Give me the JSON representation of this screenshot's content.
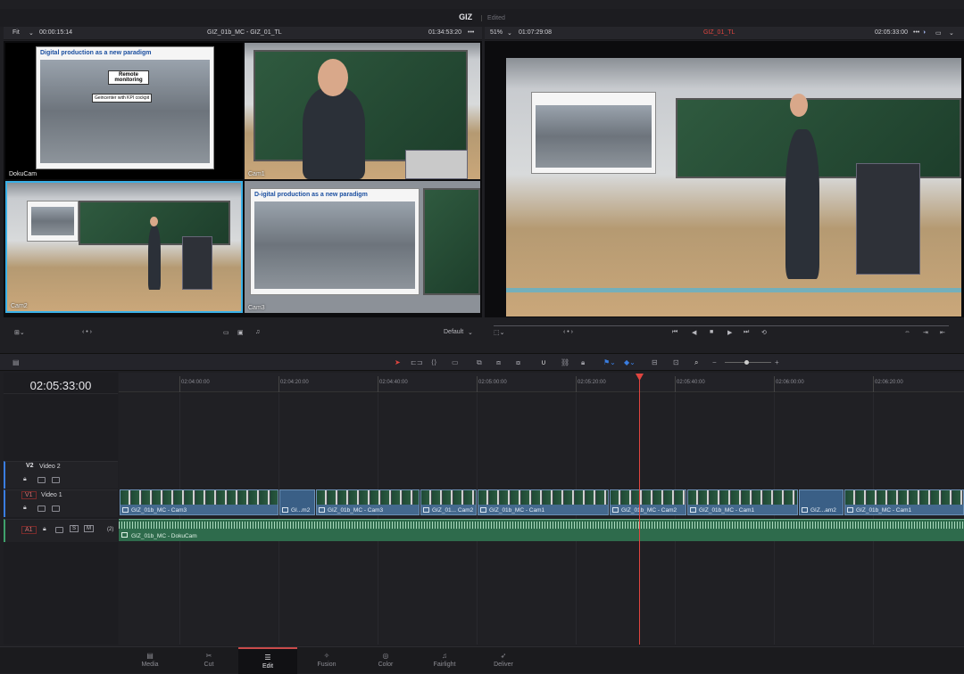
{
  "app": {
    "project_title": "GIZ",
    "status": "Edited"
  },
  "source_viewer": {
    "zoom": "Fit",
    "duration": "00:00:15:14",
    "clip_name": "GIZ_01b_MC - GIZ_01_TL",
    "timecode": "01:34:53:20",
    "more": "•••",
    "angles": [
      {
        "label": "DokuCam"
      },
      {
        "label": "Cam1"
      },
      {
        "label": "Cam2"
      },
      {
        "label": "Cam3"
      }
    ],
    "slide_title": "Digital production as a new paradigm",
    "slide_title_cam3": "D-igital production as a new paradigm",
    "slide_callout": "Remote monitoring",
    "slide_callout2": "Geincenter with KPI cockpit",
    "nav": "‹ • ›"
  },
  "timeline_viewer": {
    "zoom": "51%",
    "duration": "01:07:29:08",
    "timeline_name": "GIZ_01_TL",
    "timecode": "02:05:33:00",
    "more": "•••",
    "audio_preset": "Default",
    "nav": "‹ • ›"
  },
  "timeline": {
    "current_timecode": "02:05:33:00",
    "ruler": [
      "02:04:00:00",
      "02:04:20:00",
      "02:04:40:00",
      "02:05:00:00",
      "02:05:20:00",
      "02:05:40:00",
      "02:06:00:00",
      "02:06:20:00"
    ],
    "tracks": {
      "v2": {
        "id": "V2",
        "name": "Video 2"
      },
      "v1": {
        "id": "V1",
        "name": "Video 1"
      },
      "a1": {
        "id": "A1",
        "name": "",
        "channels": "(2)",
        "solo": "S",
        "mute": "M"
      }
    },
    "clips": [
      {
        "label": "GIZ_01b_MC - Cam3"
      },
      {
        "label": "GI...m2"
      },
      {
        "label": "GIZ_01b_MC - Cam3"
      },
      {
        "label": "GIZ_01... Cam2"
      },
      {
        "label": "GIZ_01b_MC - Cam1"
      },
      {
        "label": "GIZ_01b_MC - Cam2"
      },
      {
        "label": "GIZ_01b_MC - Cam1"
      },
      {
        "label": "GIZ...am2"
      },
      {
        "label": "GIZ_01b_MC - Cam1"
      }
    ],
    "audio_clip": "GIZ_01b_MC - DokuCam",
    "colors": {
      "video_clip": "#44698e",
      "audio_clip": "#2e6b4c",
      "playhead": "#e0453f"
    }
  },
  "pages": [
    {
      "label": "Media",
      "icon": "media-icon"
    },
    {
      "label": "Cut",
      "icon": "cut-icon"
    },
    {
      "label": "Edit",
      "icon": "edit-icon",
      "active": true
    },
    {
      "label": "Fusion",
      "icon": "fusion-icon"
    },
    {
      "label": "Color",
      "icon": "color-icon"
    },
    {
      "label": "Fairlight",
      "icon": "fairlight-icon"
    },
    {
      "label": "Deliver",
      "icon": "deliver-icon"
    }
  ]
}
